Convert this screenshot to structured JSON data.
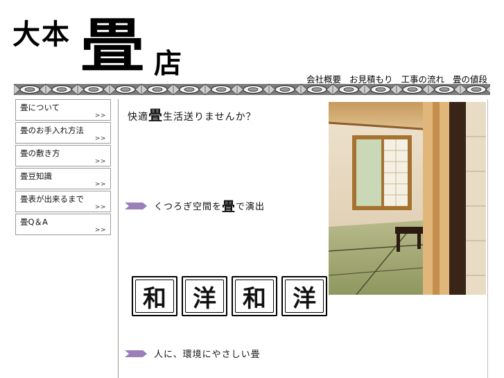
{
  "brand": {
    "line1": "大本",
    "line2": "畳",
    "line3": "店"
  },
  "topnav": [
    {
      "label": "会社概要"
    },
    {
      "label": "お見積もり"
    },
    {
      "label": "工事の流れ"
    },
    {
      "label": "畳の値段"
    }
  ],
  "sidebar": {
    "items": [
      {
        "label": "畳について",
        "arrow": ">>"
      },
      {
        "label": "畳のお手入れ方法",
        "arrow": ">>"
      },
      {
        "label": "畳の敷き方",
        "arrow": ">>"
      },
      {
        "label": "畳豆知識",
        "arrow": ">>"
      },
      {
        "label": "畳表が出来るまで",
        "arrow": ">>"
      },
      {
        "label": "畳Q＆A",
        "arrow": ">>"
      }
    ]
  },
  "main": {
    "headline_pre": "快適",
    "headline_big": "畳",
    "headline_post": "生活送りませんか？",
    "line2_pre": "くつろぎ空間を",
    "line2_big": "畳",
    "line2_post": "で演出",
    "wayo": [
      "和",
      "洋",
      "和",
      "洋"
    ],
    "line3": "人に、環境にやさしい畳"
  },
  "colors": {
    "accent_purple": "#9b7fb8",
    "band_gray": "#8a8a8a",
    "border_gray": "#9a9a9a"
  }
}
